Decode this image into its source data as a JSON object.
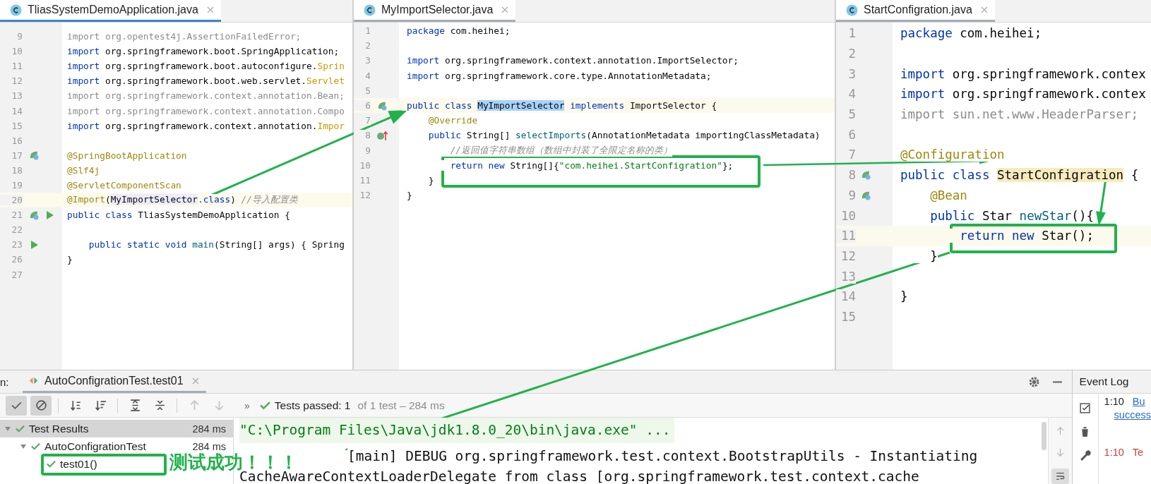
{
  "editors": [
    {
      "tab": {
        "title": "TliasSystemDemoApplication.java",
        "selected": true,
        "focused": true
      },
      "lines": [
        {
          "number": "9",
          "tokens": [
            {
              "kind": "unused",
              "text": "import org.opentest4j.AssertionFailedError;"
            }
          ]
        },
        {
          "number": "10",
          "tokens": [
            {
              "kind": "keyword",
              "text": "import "
            },
            {
              "kind": "plain",
              "text": "org.springframework.boot.SpringApplication;"
            }
          ]
        },
        {
          "number": "11",
          "tokens": [
            {
              "kind": "keyword",
              "text": "import "
            },
            {
              "kind": "plain",
              "text": "org.springframework.boot.autoconfigure."
            },
            {
              "kind": "warning",
              "text": "Sprin"
            }
          ]
        },
        {
          "number": "12",
          "tokens": [
            {
              "kind": "keyword",
              "text": "import "
            },
            {
              "kind": "plain",
              "text": "org.springframework.boot.web.servlet."
            },
            {
              "kind": "warning",
              "text": "Servlet"
            }
          ]
        },
        {
          "number": "13",
          "tokens": [
            {
              "kind": "unused",
              "text": "import org.springframework.context.annotation.Bean;"
            }
          ]
        },
        {
          "number": "14",
          "tokens": [
            {
              "kind": "unused",
              "text": "import org.springframework.context.annotation.Compo"
            }
          ]
        },
        {
          "number": "15",
          "tokens": [
            {
              "kind": "keyword",
              "text": "import "
            },
            {
              "kind": "plain",
              "text": "org.springframework.context.annotation."
            },
            {
              "kind": "warning",
              "text": "Impor"
            }
          ]
        },
        {
          "number": "16"
        },
        {
          "number": "17",
          "gutter_icons": [
            {
              "kind": "bean"
            }
          ],
          "tokens": [
            {
              "kind": "annotation",
              "text": "@SpringBootApplication"
            }
          ]
        },
        {
          "number": "18",
          "tokens": [
            {
              "kind": "annotation",
              "text": "@Slf4j"
            }
          ]
        },
        {
          "number": "19",
          "tokens": [
            {
              "kind": "annotation",
              "text": "@ServletComponentScan"
            }
          ]
        },
        {
          "number": "20",
          "current": true,
          "tokens": [
            {
              "kind": "annotation",
              "text": "@Import"
            },
            {
              "kind": "plain",
              "text": "("
            },
            {
              "kind": "reference",
              "text": "MyImportSelector"
            },
            {
              "kind": "keyword",
              "text": ".class"
            },
            {
              "kind": "plain",
              "text": ") "
            },
            {
              "kind": "comment",
              "text": "//导入配置类"
            }
          ]
        },
        {
          "number": "21",
          "gutter_icons": [
            {
              "kind": "bean"
            },
            {
              "kind": "run"
            }
          ],
          "tokens": [
            {
              "kind": "keyword",
              "text": "public class "
            },
            {
              "kind": "plain",
              "text": "TliasSystemDemoApplication {"
            }
          ]
        },
        {
          "number": "22"
        },
        {
          "number": "23",
          "gutter_icons": [
            {
              "kind": "run"
            }
          ],
          "tokens": [
            {
              "kind": "keyword",
              "text": "    public static void "
            },
            {
              "kind": "method",
              "text": "main"
            },
            {
              "kind": "plain",
              "text": "(String[] args) { Spring"
            }
          ]
        },
        {
          "number": "26",
          "tokens": [
            {
              "kind": "plain",
              "text": "}"
            }
          ]
        },
        {
          "number": "27"
        }
      ]
    },
    {
      "tab": {
        "title": "MyImportSelector.java",
        "selected": true,
        "focused": false
      },
      "lines": [
        {
          "number": "1",
          "tokens": [
            {
              "kind": "keyword",
              "text": "package "
            },
            {
              "kind": "plain",
              "text": "com.heihei;"
            }
          ]
        },
        {
          "number": "2"
        },
        {
          "number": "3",
          "tokens": [
            {
              "kind": "keyword",
              "text": "import "
            },
            {
              "kind": "plain",
              "text": "org.springframework.context.annotation.ImportSelector;"
            }
          ]
        },
        {
          "number": "4",
          "tokens": [
            {
              "kind": "keyword",
              "text": "import "
            },
            {
              "kind": "plain",
              "text": "org.springframework.core.type.AnnotationMetadata;"
            }
          ]
        },
        {
          "number": "5"
        },
        {
          "number": "6",
          "current": true,
          "gutter_icons": [
            {
              "kind": "bean"
            }
          ],
          "tokens": [
            {
              "kind": "keyword",
              "text": "public class "
            },
            {
              "kind": "selection",
              "text": "MyImportSelector"
            },
            {
              "kind": "keyword",
              "text": " implements "
            },
            {
              "kind": "plain",
              "text": "ImportSelector {"
            }
          ]
        },
        {
          "number": "7",
          "tokens": [
            {
              "kind": "annotation",
              "text": "    @Override"
            }
          ]
        },
        {
          "number": "8",
          "gutter_icons": [
            {
              "kind": "implements"
            }
          ],
          "tokens": [
            {
              "kind": "keyword",
              "text": "    public "
            },
            {
              "kind": "plain",
              "text": "String[] "
            },
            {
              "kind": "method",
              "text": "selectImports"
            },
            {
              "kind": "plain",
              "text": "(AnnotationMetadata importingClassMetadata)"
            }
          ]
        },
        {
          "number": "9",
          "tokens": [
            {
              "kind": "comment",
              "text": "        //返回值字符串数组（数组中封装了全限定名称的类）"
            }
          ]
        },
        {
          "number": "10",
          "tokens": [
            {
              "kind": "keyword",
              "text": "        return new "
            },
            {
              "kind": "plain",
              "text": "String[]{"
            },
            {
              "kind": "string",
              "text": "\"com.heihei.StartConfigration\""
            },
            {
              "kind": "plain",
              "text": "};"
            }
          ]
        },
        {
          "number": "11",
          "tokens": [
            {
              "kind": "plain",
              "text": "    }"
            }
          ]
        },
        {
          "number": "12",
          "tokens": [
            {
              "kind": "plain",
              "text": "}"
            }
          ]
        }
      ]
    },
    {
      "tab": {
        "title": "StartConfigration.java",
        "selected": true,
        "focused": false
      },
      "lines": [
        {
          "number": "1",
          "tokens": [
            {
              "kind": "keyword",
              "text": "package "
            },
            {
              "kind": "plain",
              "text": "com.heihei;"
            }
          ]
        },
        {
          "number": "2"
        },
        {
          "number": "3",
          "tokens": [
            {
              "kind": "keyword",
              "text": "import "
            },
            {
              "kind": "plain",
              "text": "org.springframework.contex"
            }
          ]
        },
        {
          "number": "4",
          "tokens": [
            {
              "kind": "keyword",
              "text": "import "
            },
            {
              "kind": "plain",
              "text": "org.springframework.contex"
            }
          ]
        },
        {
          "number": "5",
          "tokens": [
            {
              "kind": "unused",
              "text": "import sun.net.www.HeaderParser;"
            }
          ]
        },
        {
          "number": "6"
        },
        {
          "number": "7",
          "tokens": [
            {
              "kind": "annotation",
              "text": "@Configuration"
            }
          ]
        },
        {
          "number": "8",
          "gutter_icons": [
            {
              "kind": "bean"
            }
          ],
          "tokens": [
            {
              "kind": "keyword",
              "text": "public class "
            },
            {
              "kind": "usage",
              "text": "StartConfigration"
            },
            {
              "kind": "plain",
              "text": " {"
            }
          ]
        },
        {
          "number": "9",
          "gutter_icons": [
            {
              "kind": "bean"
            }
          ],
          "tokens": [
            {
              "kind": "annotation",
              "text": "    @Bean"
            }
          ]
        },
        {
          "number": "10",
          "tokens": [
            {
              "kind": "keyword",
              "text": "    public "
            },
            {
              "kind": "plain",
              "text": "Star "
            },
            {
              "kind": "method",
              "text": "newStar"
            },
            {
              "kind": "plain",
              "text": "(){"
            }
          ]
        },
        {
          "number": "11",
          "current": true,
          "tokens": [
            {
              "kind": "keyword",
              "text": "        return new "
            },
            {
              "kind": "plain",
              "text": "Star();"
            }
          ]
        },
        {
          "number": "12",
          "tokens": [
            {
              "kind": "plain",
              "text": "    }"
            }
          ]
        },
        {
          "number": "13"
        },
        {
          "number": "14",
          "tokens": [
            {
              "kind": "plain",
              "text": "}"
            }
          ]
        },
        {
          "number": "15"
        }
      ]
    }
  ],
  "run_panel": {
    "label": "n:",
    "tab": {
      "title": "AutoConfigrationTest.test01",
      "selected": true
    },
    "toolbar": [
      {
        "kind": "show-passed",
        "on": true,
        "disabled": false
      },
      {
        "kind": "show-ignored",
        "on": true,
        "disabled": false
      },
      {
        "kind": "sort-alpha",
        "on": false,
        "disabled": false
      },
      {
        "kind": "sort-duration",
        "on": false,
        "disabled": false
      },
      {
        "kind": "expand-all",
        "on": false,
        "disabled": false
      },
      {
        "kind": "collapse-all",
        "on": false,
        "disabled": false
      },
      {
        "kind": "previous",
        "on": false,
        "disabled": true
      },
      {
        "kind": "next",
        "on": false,
        "disabled": true
      }
    ],
    "more": "»",
    "status": {
      "passed": "Tests passed: 1",
      "detail": "of 1 test – 284 ms"
    },
    "tree": [
      {
        "label": "Test Results",
        "time": "284 ms",
        "selected": true,
        "expanded": true,
        "children": [
          {
            "label": "AutoConfigrationTest",
            "time": "284 ms",
            "selected": false,
            "expanded": true,
            "children": [
              {
                "label": "test01()",
                "selected": false
              }
            ]
          }
        ]
      }
    ],
    "console": [
      {
        "kind": "command",
        "text": "\"C:\\Program Files\\Java\\jdk1.8.0_20\\bin\\java.exe\" ..."
      },
      {
        "kind": "output",
        "text": "[main] DEBUG org.springframework.test.context.BootstrapUtils - Instantiating"
      },
      {
        "kind": "output",
        "text": "CacheAwareContextLoaderDelegate from class [org.springframework.test.context.cache"
      }
    ]
  },
  "event_log": {
    "title": "Event Log",
    "entries": [
      {
        "time": "1:10",
        "message": "Bu",
        "more": "success",
        "kind": "info"
      },
      {
        "time": "1:10",
        "message": "Te",
        "kind": "error"
      }
    ]
  },
  "annotation": {
    "text": "测试成功！！！"
  }
}
